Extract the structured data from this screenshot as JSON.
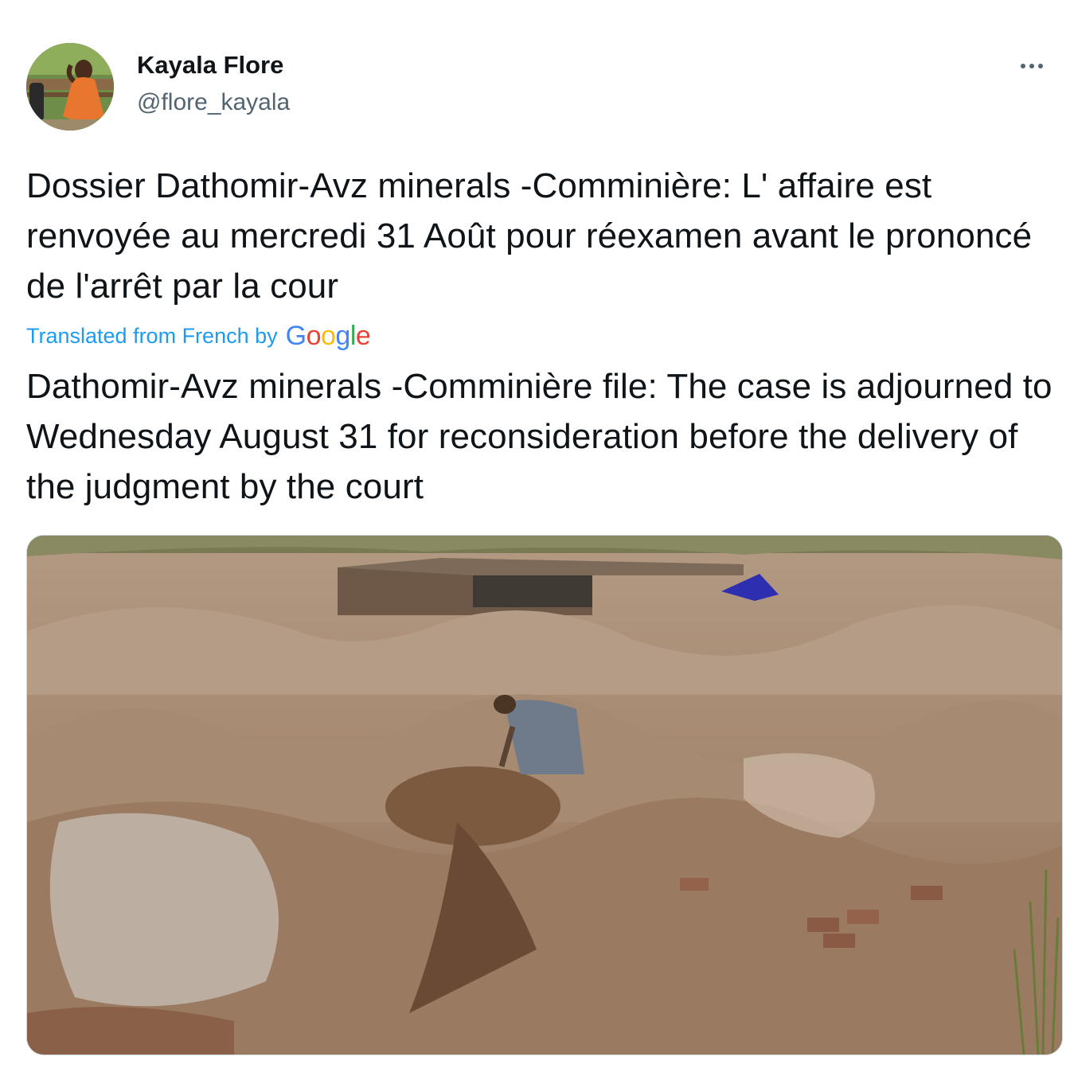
{
  "author": {
    "name": "Kayala Flore",
    "handle": "@flore_kayala"
  },
  "tweet": {
    "original_text": "Dossier Dathomir-Avz minerals -Comminière: L' affaire est renvoyée au mercredi 31 Août pour réexamen avant le prononcé de l'arrêt par la cour",
    "translated_by_label": "Translated from French by",
    "translation_provider": "Google",
    "translated_text": "Dathomir-Avz minerals -Comminière file: The case is adjourned to Wednesday August 31 for reconsideration before the delivery of the judgment by the court"
  },
  "icons": {
    "more": "more-options-icon"
  },
  "colors": {
    "text": "#0f1419",
    "secondary": "#536471",
    "link": "#1d9bf0",
    "border": "#cfd9de"
  }
}
